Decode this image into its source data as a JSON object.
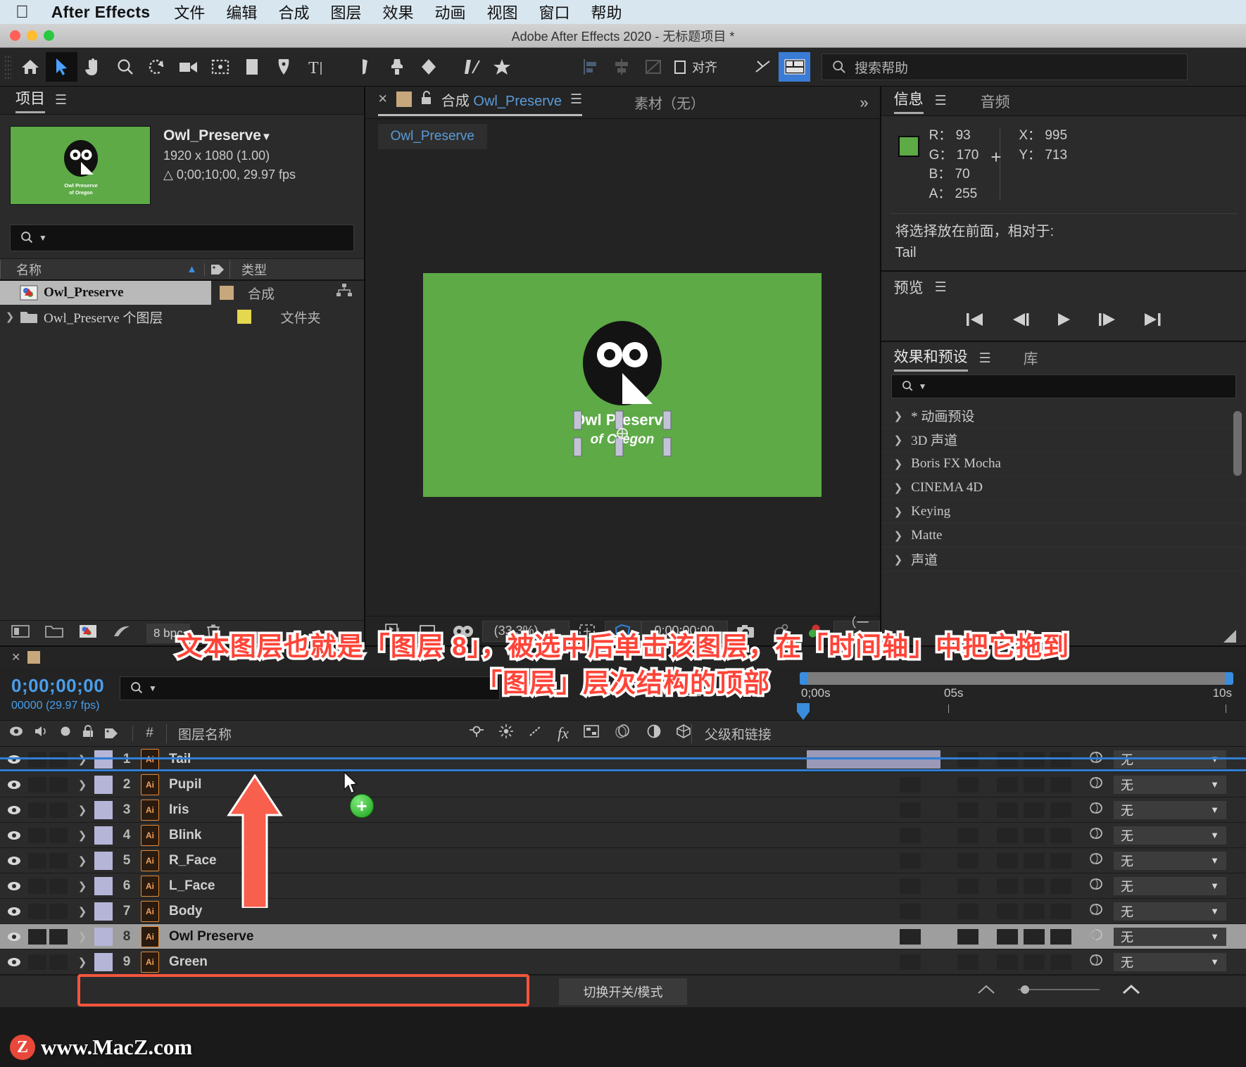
{
  "macmenu": {
    "apple": "apple-logo",
    "app": "After Effects",
    "items": [
      "文件",
      "编辑",
      "合成",
      "图层",
      "效果",
      "动画",
      "视图",
      "窗口",
      "帮助"
    ]
  },
  "titlebar": {
    "title": "Adobe After Effects 2020 - 无标题项目 *"
  },
  "toolbar": {
    "align_label": "对齐",
    "search_placeholder": "搜索帮助",
    "tools": [
      "home-icon",
      "selection-tool",
      "hand-tool",
      "zoom-tool",
      "rotation-tool",
      "camera-tool",
      "pan-behind-tool",
      "shape-tool",
      "pen-tool",
      "text-tool",
      "brush-tool",
      "clone-stamp-tool",
      "eraser-tool",
      "roto-brush-tool",
      "puppet-pin-tool"
    ]
  },
  "project": {
    "tab_label": "项目",
    "item_name": "Owl_Preserve",
    "resolution": "1920 x 1080 (1.00)",
    "duration": "△ 0;00;10;00, 29.97 fps",
    "search_placeholder": "",
    "columns": {
      "name": "名称",
      "type": "类型"
    },
    "rows": [
      {
        "name": "Owl_Preserve",
        "type": "合成",
        "swatch": "#c7a87c",
        "selected": true
      },
      {
        "name": "Owl_Preserve 个图层",
        "type": "文件夹",
        "swatch": "#e3d84e",
        "selected": false
      }
    ]
  },
  "comp": {
    "tab_prefix": "合成",
    "tab_name": "Owl_Preserve",
    "footage_tab": "素材（无）",
    "crumb": "Owl_Preserve",
    "bg_color": "#5daa46",
    "art_title_line1": "Owl Preserve",
    "art_title_line2": "of Oregon",
    "bar": {
      "zoom": "(33.3%)",
      "time": "0:00:00;00",
      "view_label": "（一分"
    }
  },
  "info": {
    "tab_label": "信息",
    "audio_tab": "音频",
    "swatch": "#5daa46",
    "r_label": "R：",
    "r": "93",
    "g_label": "G：",
    "g": "170",
    "b_label": "B：",
    "b": "70",
    "a_label": "A：",
    "a": "255",
    "x_label": "X：",
    "x": "995",
    "y_label": "Y：",
    "y": "713",
    "message_line1": "将选择放在前面，相对于:",
    "message_line2": "Tail"
  },
  "preview": {
    "tab_label": "预览",
    "buttons": [
      "first-frame-icon",
      "prev-frame-icon",
      "play-icon",
      "next-frame-icon",
      "last-frame-icon"
    ]
  },
  "effects": {
    "tab_label": "效果和预设",
    "library_tab": "库",
    "search_placeholder": "",
    "items": [
      "* 动画预设",
      "3D 声道",
      "Boris FX Mocha",
      "CINEMA 4D",
      "Keying",
      "Matte",
      "声道"
    ]
  },
  "timeline": {
    "timecode": "0;00;00;00",
    "frames": "00000 (29.97 fps)",
    "search_placeholder": "",
    "columns": {
      "layer_name": "图层名称",
      "hash": "#",
      "parent": "父级和链接"
    },
    "ruler": {
      "t0": "0;00s",
      "t5": "05s",
      "t10": "10s"
    },
    "parent_none": "无",
    "switch_mode": "切换开关/模式",
    "layers": [
      {
        "num": "1",
        "name": "Tail",
        "selected": false
      },
      {
        "num": "2",
        "name": "Pupil",
        "selected": false
      },
      {
        "num": "3",
        "name": "Iris",
        "selected": false
      },
      {
        "num": "4",
        "name": "Blink",
        "selected": false
      },
      {
        "num": "5",
        "name": "R_Face",
        "selected": false
      },
      {
        "num": "6",
        "name": "L_Face",
        "selected": false
      },
      {
        "num": "7",
        "name": "Body",
        "selected": false
      },
      {
        "num": "8",
        "name": "Owl Preserve",
        "selected": true
      },
      {
        "num": "9",
        "name": "Green",
        "selected": false
      }
    ]
  },
  "annotation": {
    "line1": "文本图层也就是「图层 8」，被选中后单击该图层，在「时间轴」中把它拖到",
    "line2": "「图层」层次结构的顶部",
    "color": "#ff4438"
  },
  "watermark": {
    "icon": "Z",
    "text": "www.MacZ.com"
  }
}
